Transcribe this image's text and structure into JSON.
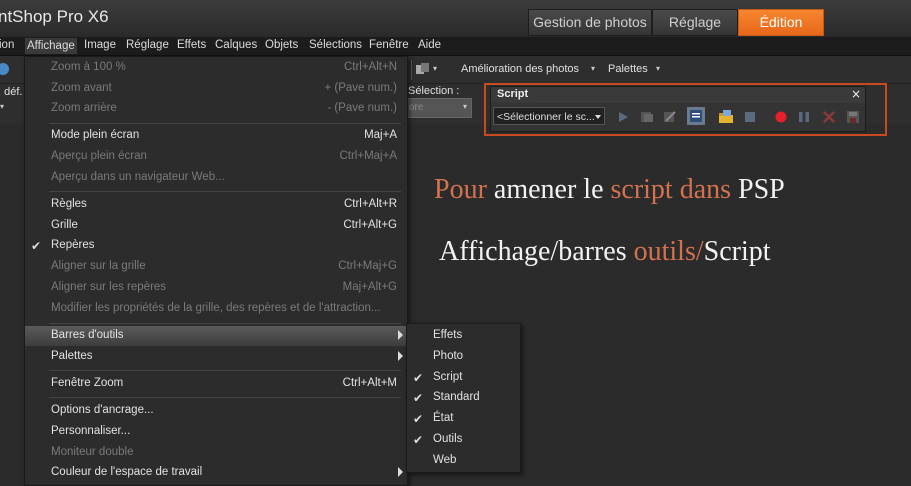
{
  "app": {
    "title": "ntShop Pro X6"
  },
  "workspace_tabs": [
    {
      "label": "Gestion de photos",
      "active": false
    },
    {
      "label": "Réglage",
      "active": false
    },
    {
      "label": "Édition",
      "active": true
    }
  ],
  "menubar": [
    "ion",
    "Affichage",
    "Image",
    "Réglage",
    "Effets",
    "Calques",
    "Objets",
    "Sélections",
    "Fenêtre",
    "Aide"
  ],
  "toolbar": {
    "left_label": ". déf.",
    "photo_enh": "Amélioration des photos",
    "palettes": "Palettes",
    "selection_label": "Sélection :",
    "selection_value": "ore"
  },
  "view_menu": {
    "items": [
      {
        "label": "Zoom à 100 %",
        "shortcut": "Ctrl+Alt+N",
        "enabled": false
      },
      {
        "label": "Zoom avant",
        "shortcut": "+ (Pave num.)",
        "enabled": false
      },
      {
        "label": "Zoom arrière",
        "shortcut": "- (Pave num.)",
        "enabled": false
      },
      {
        "label": "Mode plein écran",
        "shortcut": "Maj+A",
        "enabled": true
      },
      {
        "label": "Aperçu plein écran",
        "shortcut": "Ctrl+Maj+A",
        "enabled": false
      },
      {
        "label": "Aperçu dans un navigateur Web...",
        "shortcut": "",
        "enabled": false
      },
      {
        "label": "Règles",
        "shortcut": "Ctrl+Alt+R",
        "enabled": true
      },
      {
        "label": "Grille",
        "shortcut": "Ctrl+Alt+G",
        "enabled": true
      },
      {
        "label": "Repères",
        "shortcut": "",
        "enabled": true,
        "checked": true
      },
      {
        "label": "Aligner sur la grille",
        "shortcut": "Ctrl+Maj+G",
        "enabled": false
      },
      {
        "label": "Aligner sur les repères",
        "shortcut": "Maj+Alt+G",
        "enabled": false
      },
      {
        "label": "Modifier les propriétés de la grille, des repères et de l'attraction...",
        "shortcut": "",
        "enabled": false
      },
      {
        "label": "Barres d'outils",
        "shortcut": "",
        "enabled": true,
        "submenu": true,
        "highlighted": true
      },
      {
        "label": "Palettes",
        "shortcut": "",
        "enabled": true,
        "submenu": true
      },
      {
        "label": "Fenêtre Zoom",
        "shortcut": "Ctrl+Alt+M",
        "enabled": true
      },
      {
        "label": "Options d'ancrage...",
        "shortcut": "",
        "enabled": true
      },
      {
        "label": "Personnaliser...",
        "shortcut": "",
        "enabled": true
      },
      {
        "label": "Moniteur double",
        "shortcut": "",
        "enabled": false
      },
      {
        "label": "Couleur de l'espace de travail",
        "shortcut": "",
        "enabled": true,
        "submenu": true
      }
    ]
  },
  "toolbars_submenu": {
    "items": [
      {
        "label": "Effets",
        "checked": false
      },
      {
        "label": "Photo",
        "checked": false
      },
      {
        "label": "Script",
        "checked": true
      },
      {
        "label": "Standard",
        "checked": true
      },
      {
        "label": "État",
        "checked": true
      },
      {
        "label": "Outils",
        "checked": true
      },
      {
        "label": "Web",
        "checked": false
      }
    ]
  },
  "script_panel": {
    "title": "Script",
    "close": "×",
    "select_value": "<Sélectionner le sc..."
  },
  "annotation": {
    "line1_a": "Pour",
    "line1_b": " amener le ",
    "line1_c": "script dans",
    "line1_d": " PSP",
    "line2_a": "Affichage/barres ",
    "line2_b": "outils/",
    "line2_c": "Script"
  },
  "colors": {
    "accent": "#e7671a",
    "highlight_box": "#c84a1e",
    "annotation_orange": "#d2724f"
  }
}
